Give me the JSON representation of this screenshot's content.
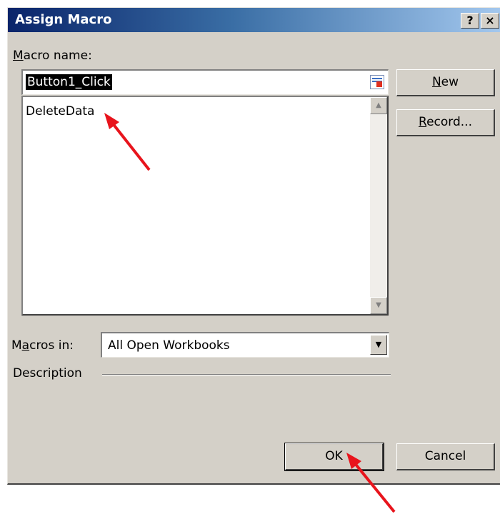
{
  "window": {
    "title": "Assign Macro",
    "help_btn": "?",
    "close_btn": "×"
  },
  "macro_name": {
    "label_hot": "M",
    "label_rest": "acro name:",
    "value": "Button1_Click"
  },
  "macros_list": {
    "items": [
      "DeleteData"
    ]
  },
  "buttons": {
    "new_hot": "N",
    "new_rest": "ew",
    "record_hot": "R",
    "record_rest": "ecord...",
    "ok": "OK",
    "cancel": "Cancel"
  },
  "macros_in": {
    "label_pre": "M",
    "label_hot": "a",
    "label_rest": "cros in:",
    "value": "All Open Workbooks"
  },
  "description": {
    "label": "Description"
  },
  "colors": {
    "annotation_arrow": "#e8141c",
    "titlebar_start": "#0a246a",
    "dialog_bg": "#d4d0c8"
  },
  "icons": {
    "refedit": "refedit-icon",
    "scroll_up": "scroll-up-arrow-icon",
    "scroll_down": "scroll-down-arrow-icon",
    "combo_dropdown": "chevron-down-icon"
  }
}
